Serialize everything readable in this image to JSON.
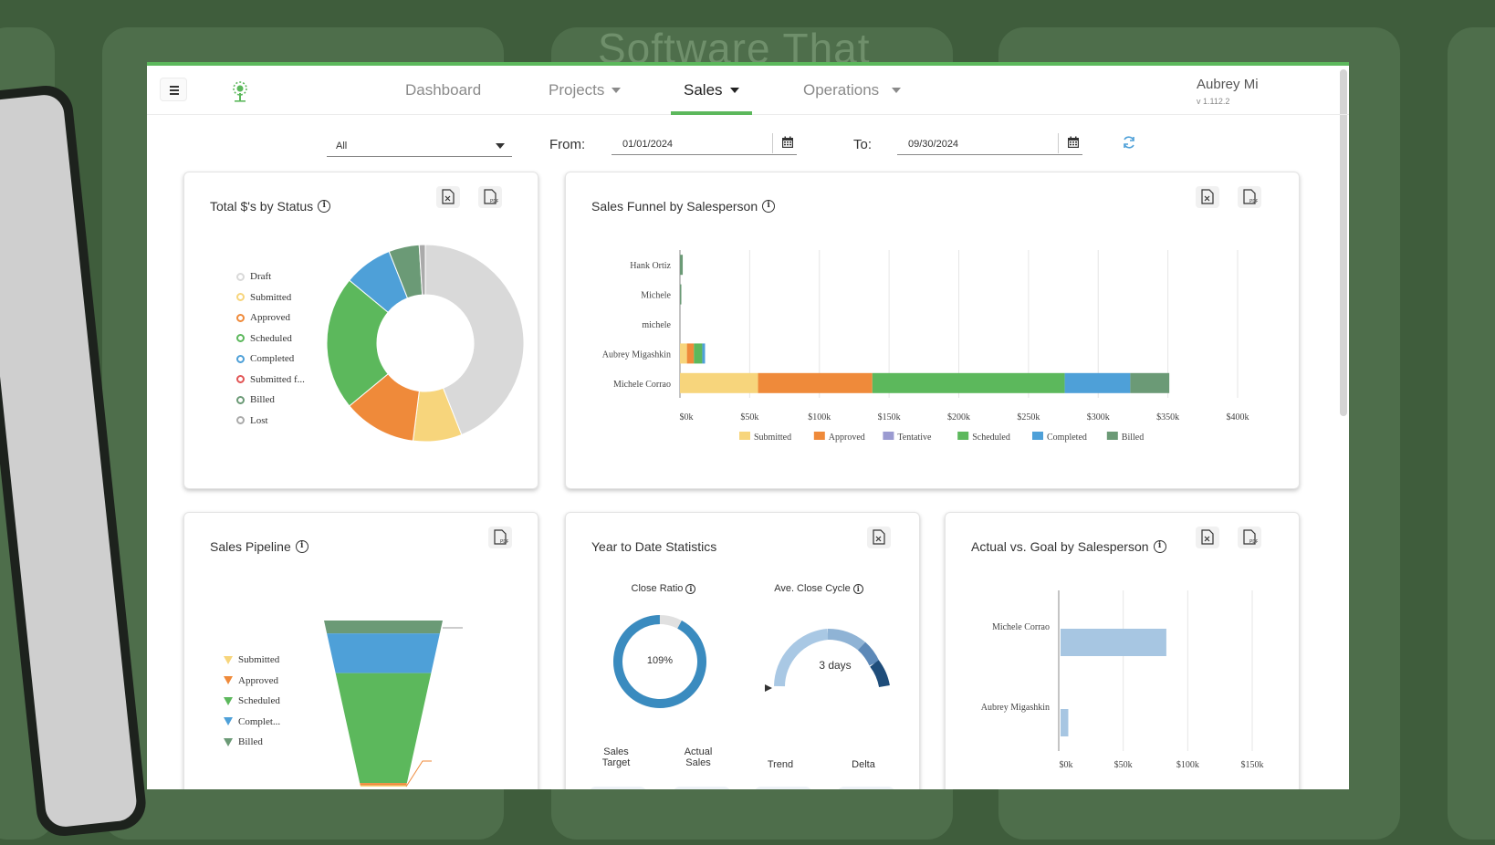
{
  "background": {
    "slogan": "Software That"
  },
  "topbar": {
    "nav": [
      {
        "label": "Dashboard",
        "has_caret": false,
        "active": false
      },
      {
        "label": "Projects",
        "has_caret": true,
        "active": false
      },
      {
        "label": "Sales",
        "has_caret": true,
        "active": true
      },
      {
        "label": "Operations",
        "has_caret": true,
        "active": false
      }
    ],
    "user_name": "Aubrey Mi",
    "version": "v 1.112.2"
  },
  "filters": {
    "salesperson_selected": "All",
    "from_label": "From:",
    "from_value": "01/01/2024",
    "to_label": "To:",
    "to_value": "09/30/2024"
  },
  "cards": {
    "status": {
      "title": "Total $'s by Status",
      "legend": [
        "Draft",
        "Submitted",
        "Approved",
        "Scheduled",
        "Completed",
        "Submitted f...",
        "Billed",
        "Lost"
      ]
    },
    "funnel": {
      "title": "Sales Funnel by Salesperson"
    },
    "pipeline": {
      "title": "Sales Pipeline",
      "legend": [
        "Submitted",
        "Approved",
        "Scheduled",
        "Complet...",
        "Billed"
      ]
    },
    "ytd": {
      "title": "Year to Date Statistics",
      "close_ratio_label": "Close Ratio",
      "close_ratio_value": "109%",
      "close_cycle_label": "Ave. Close Cycle",
      "close_cycle_value": "3 days",
      "columns": [
        "Sales\nTarget",
        "Actual\nSales",
        "Trend",
        "Delta"
      ]
    },
    "goal": {
      "title": "Actual vs. Goal by Salesperson"
    }
  },
  "colors": {
    "draft": "#d9d9d9",
    "submitted": "#f7d57c",
    "approved": "#ef8a3a",
    "tentative": "#9b9bd1",
    "scheduled": "#5cb85c",
    "completed": "#4ea0d8",
    "submitted_f": "#e25555",
    "billed": "#6b9a76",
    "lost": "#aaaaaa",
    "accent": "#5cb85c"
  },
  "chart_data": [
    {
      "type": "pie",
      "title": "Total $'s by Status",
      "categories": [
        "Draft",
        "Submitted",
        "Approved",
        "Scheduled",
        "Completed",
        "Submitted f...",
        "Billed",
        "Lost"
      ],
      "values": [
        44,
        8,
        12,
        22,
        8,
        0,
        5,
        1
      ]
    },
    {
      "type": "bar",
      "title": "Sales Funnel by Salesperson",
      "categories": [
        "Hank Ortiz",
        "Michele",
        "michele",
        "Aubrey Migashkin",
        "Michele Corrao"
      ],
      "xticks": [
        "$0k",
        "$50k",
        "$100k",
        "$150k",
        "$200k",
        "$250k",
        "$300k",
        "$350k",
        "$400k"
      ],
      "xlim": [
        0,
        400000
      ],
      "series": [
        {
          "name": "Submitted",
          "values": [
            0,
            0,
            0,
            5000,
            56000
          ]
        },
        {
          "name": "Approved",
          "values": [
            0,
            0,
            0,
            5000,
            82000
          ]
        },
        {
          "name": "Tentative",
          "values": [
            0,
            0,
            0,
            0,
            0
          ]
        },
        {
          "name": "Scheduled",
          "values": [
            0,
            0,
            0,
            6000,
            138000
          ]
        },
        {
          "name": "Completed",
          "values": [
            0,
            0,
            0,
            2000,
            47000
          ]
        },
        {
          "name": "Billed",
          "values": [
            2000,
            1000,
            0,
            0,
            28000
          ]
        }
      ]
    },
    {
      "type": "bar",
      "title": "Sales Pipeline",
      "categories": [
        "Billed",
        "Completed",
        "Scheduled",
        "Approved",
        "Submitted"
      ],
      "values": [
        11,
        34,
        94,
        2,
        1
      ]
    },
    {
      "type": "bar",
      "title": "Actual vs. Goal by Salesperson",
      "categories": [
        "Michele Corrao",
        "Aubrey Migashkin"
      ],
      "xticks": [
        "$0k",
        "$50k",
        "$100k",
        "$150k"
      ],
      "xlim": [
        0,
        150000
      ],
      "series": [
        {
          "name": "Actual",
          "values": [
            82000,
            6000
          ]
        }
      ]
    }
  ]
}
